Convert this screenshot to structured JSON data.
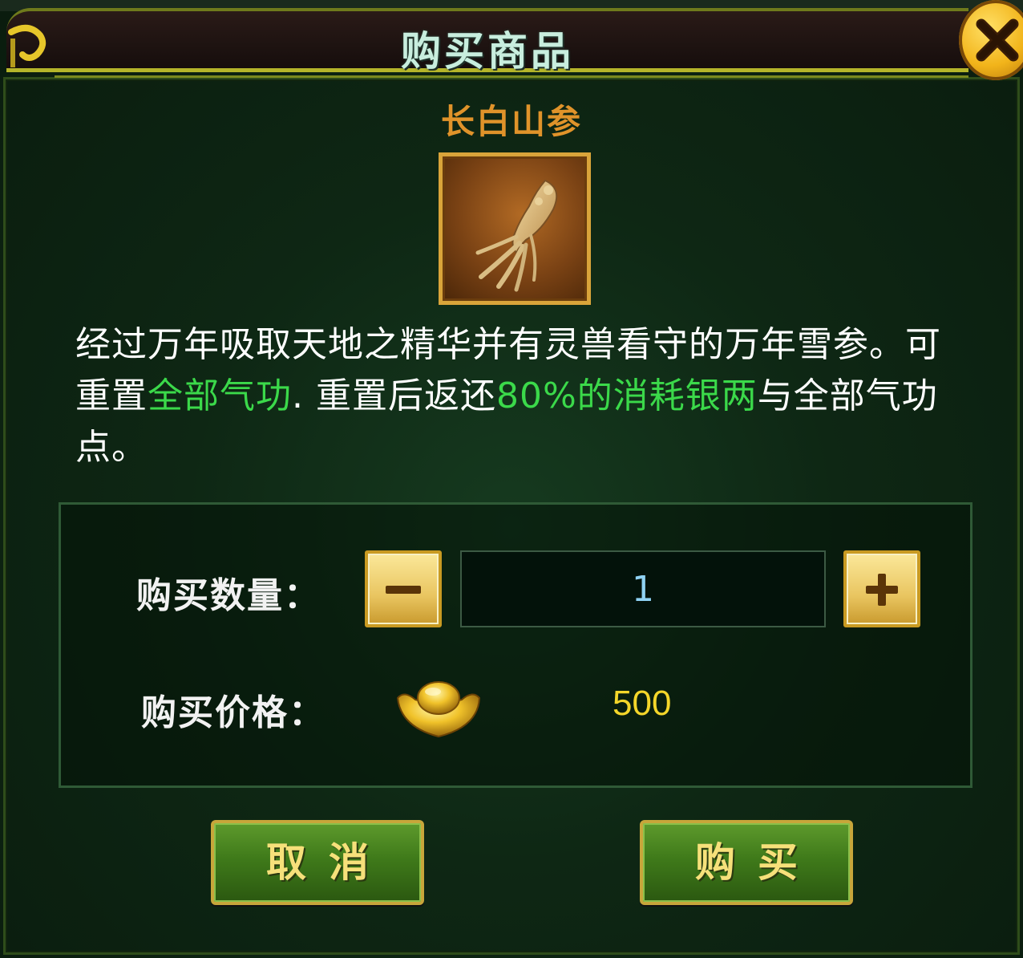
{
  "dialog": {
    "title": "购买商品",
    "close_icon": "close-x-icon"
  },
  "item": {
    "name": "长白山参",
    "icon": "ginseng-icon",
    "description": {
      "part1": "经过万年吸取天地之精华并有灵兽看守的万年雪参。可重置",
      "highlight1": "全部气功",
      "part2": ". 重置后返还",
      "highlight2": "80%的消耗银两",
      "part3": "与全部气功点。"
    }
  },
  "purchase": {
    "quantity_label": "购买数量：",
    "quantity_value": "1",
    "decrease_icon": "minus-icon",
    "increase_icon": "plus-icon",
    "price_label": "购买价格：",
    "currency_icon": "gold-ingot-icon",
    "price_value": "500"
  },
  "actions": {
    "cancel_label": "取消",
    "buy_label": "购买"
  },
  "colors": {
    "title_text": "#c8eede",
    "item_name": "#e0932a",
    "highlight_text": "#3bd94a",
    "price_text": "#f4d62a",
    "quantity_text": "#8fd2f3",
    "button_text": "#f6e07a"
  }
}
